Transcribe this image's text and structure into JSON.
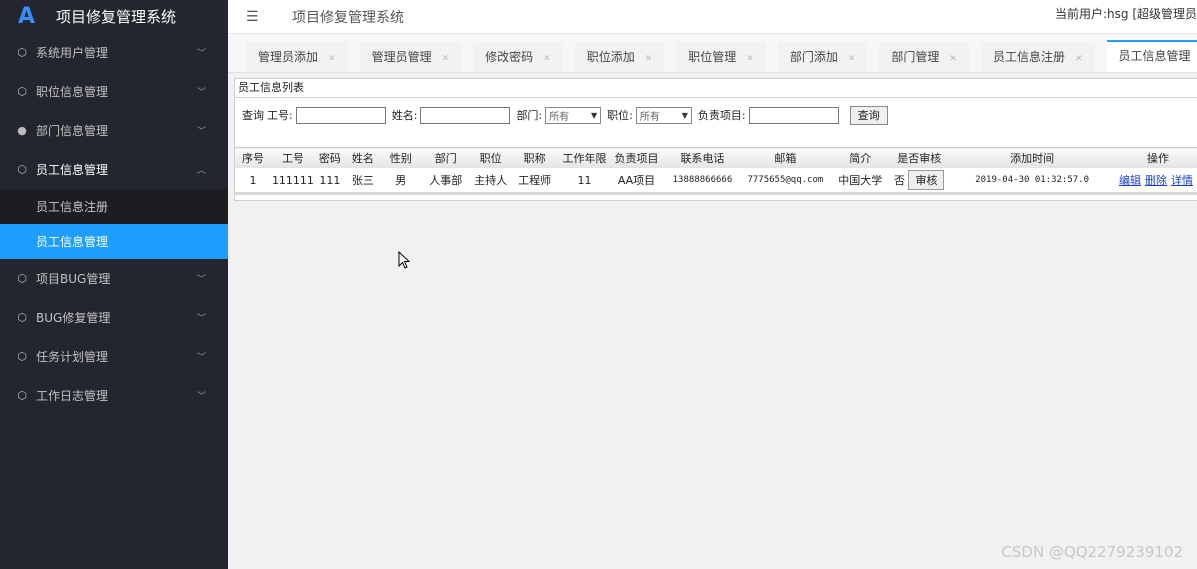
{
  "app": {
    "logo_glyph": "A",
    "title": "项目修复管理系统",
    "current_user": "当前用户:hsg [超级管理员"
  },
  "sidebar": {
    "items": [
      {
        "label": "系统用户管理",
        "icon": "cube-icon",
        "state": "collapsed"
      },
      {
        "label": "职位信息管理",
        "icon": "cube-icon",
        "state": "collapsed"
      },
      {
        "label": "部门信息管理",
        "icon": "user-icon",
        "state": "collapsed"
      },
      {
        "label": "员工信息管理",
        "icon": "cube-icon",
        "state": "expanded",
        "children": [
          {
            "label": "员工信息注册"
          },
          {
            "label": "员工信息管理",
            "active": true
          }
        ]
      },
      {
        "label": "项目BUG管理",
        "icon": "cube-icon",
        "state": "collapsed"
      },
      {
        "label": "BUG修复管理",
        "icon": "cube-icon",
        "state": "collapsed"
      },
      {
        "label": "任务计划管理",
        "icon": "cube-icon",
        "state": "collapsed"
      },
      {
        "label": "工作日志管理",
        "icon": "cube-icon",
        "state": "collapsed"
      }
    ]
  },
  "tabs": [
    {
      "label": "管理员添加"
    },
    {
      "label": "管理员管理"
    },
    {
      "label": "修改密码"
    },
    {
      "label": "职位添加"
    },
    {
      "label": "职位管理"
    },
    {
      "label": "部门添加"
    },
    {
      "label": "部门管理"
    },
    {
      "label": "员工信息注册"
    },
    {
      "label": "员工信息管理",
      "active": true
    }
  ],
  "panel": {
    "title": "员工信息列表",
    "query": {
      "prefix": "查询",
      "work_no_label": "工号:",
      "name_label": "姓名:",
      "dept_label": "部门:",
      "dept_value": "所有",
      "position_label": "职位:",
      "position_value": "所有",
      "project_label": "负责项目:",
      "search_button": "查询"
    },
    "table": {
      "headers": [
        "序号",
        "工号",
        "密码",
        "姓名",
        "性别",
        "部门",
        "职位",
        "职称",
        "工作年限",
        "负责项目",
        "联系电话",
        "邮箱",
        "简介",
        "是否审核",
        "添加时间",
        "操作"
      ],
      "rows": [
        {
          "index": "1",
          "work_no": "111111",
          "password": "111",
          "name": "张三",
          "gender": "男",
          "dept": "人事部",
          "position": "主持人",
          "title": "工程师",
          "years": "11",
          "project": "AA项目",
          "phone": "13888866666",
          "email": "7775655@qq.com",
          "intro": "中国大学",
          "audited": "否",
          "audit_button": "审核",
          "added_time": "2019-04-30 01:32:57.0",
          "ops": [
            "编辑",
            "删除",
            "详情"
          ]
        }
      ]
    }
  },
  "watermark": "CSDN @QQ2279239102",
  "colors": {
    "sidebar_bg": "#23262e",
    "accent": "#1e9fff"
  }
}
